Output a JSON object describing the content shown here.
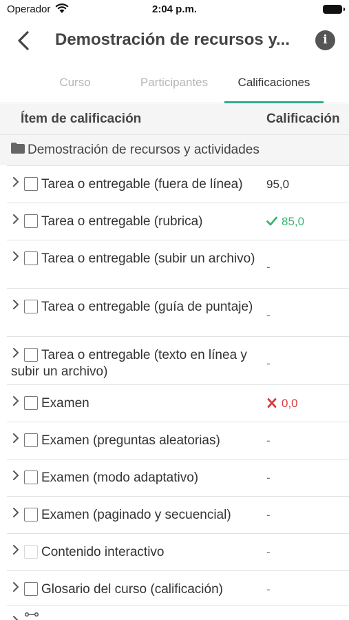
{
  "status": {
    "carrier": "Operador",
    "time": "2:04 p.m."
  },
  "nav": {
    "title": "Demostración de recursos y...",
    "info_label": "i"
  },
  "tabs": [
    {
      "label": "Curso",
      "active": false
    },
    {
      "label": "Participantes",
      "active": false
    },
    {
      "label": "Calificaciones",
      "active": true
    }
  ],
  "table": {
    "col_item": "Ítem de calificación",
    "col_grade": "Calificación",
    "category": "Demostración de recursos y actividades",
    "rows": [
      {
        "label": "Tarea o entregable (fuera de línea)",
        "grade": "95,0",
        "status": "none"
      },
      {
        "label": "Tarea o entregable (rubrica)",
        "grade": "85,0",
        "status": "pass"
      },
      {
        "label": "Tarea o entregable (subir un archivo)",
        "grade": "-",
        "status": "dash"
      },
      {
        "label": "Tarea o entregable (guía de puntaje)",
        "grade": "-",
        "status": "dash"
      },
      {
        "label": "Tarea o entregable (texto en línea y subir un archivo)",
        "grade": "-",
        "status": "dash"
      },
      {
        "label": "Examen",
        "grade": "0,0",
        "status": "fail"
      },
      {
        "label": "Examen (preguntas aleatorias)",
        "grade": "-",
        "status": "dash"
      },
      {
        "label": "Examen (modo adaptativo)",
        "grade": "-",
        "status": "dash"
      },
      {
        "label": "Examen (paginado y secuencial)",
        "grade": "-",
        "status": "dash"
      },
      {
        "label": "Contenido interactivo",
        "grade": "-",
        "status": "dash"
      },
      {
        "label": "Glosario del curso (calificación)",
        "grade": "-",
        "status": "dash"
      }
    ]
  },
  "colors": {
    "accent": "#2fa88f",
    "pass": "#3bb56d",
    "fail": "#d9393e"
  }
}
